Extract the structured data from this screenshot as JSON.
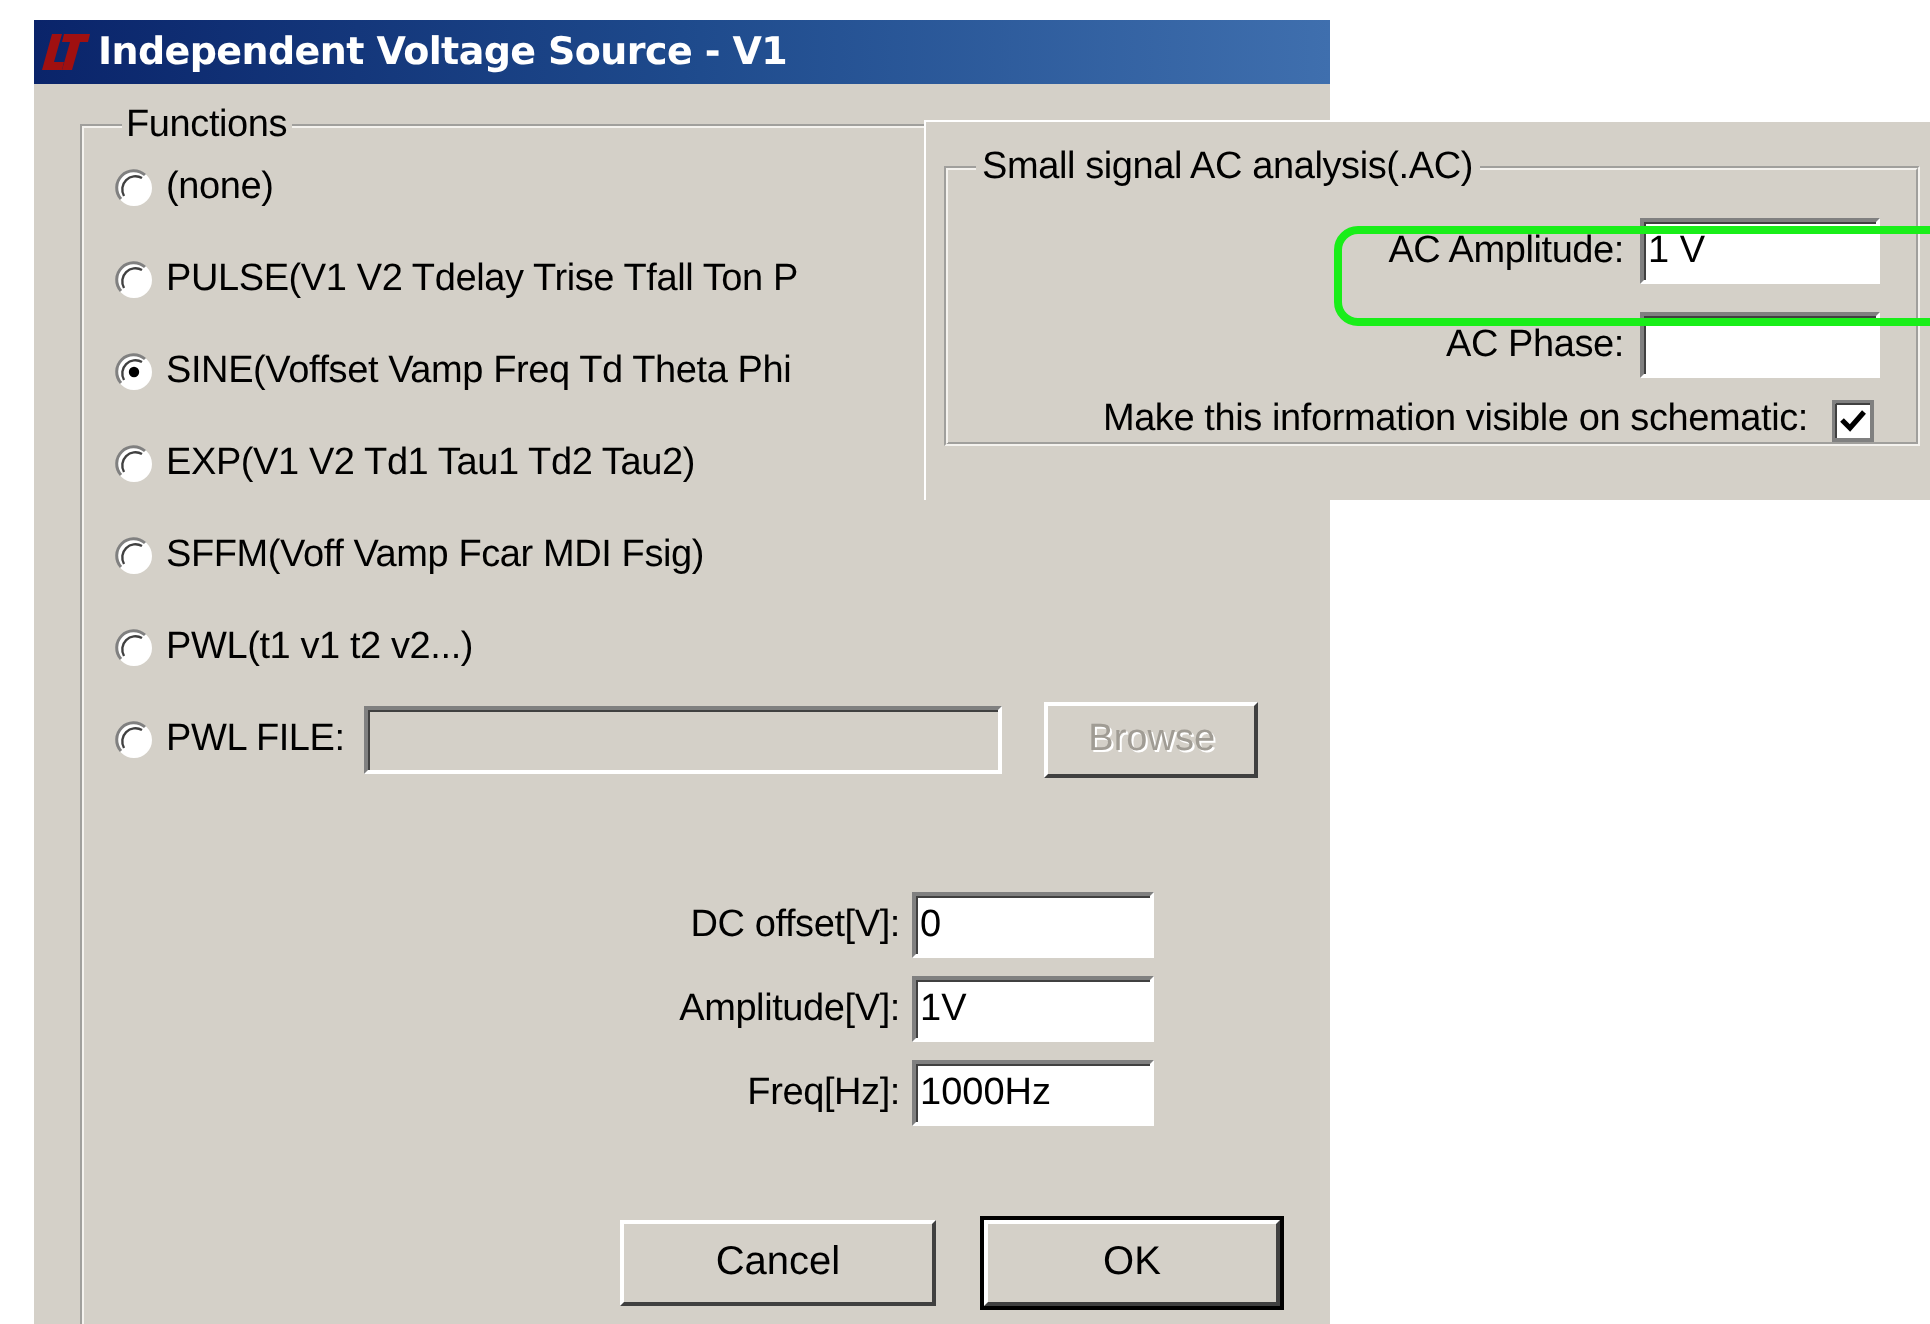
{
  "window": {
    "title": "Independent Voltage Source - V1"
  },
  "functions": {
    "label": "Functions",
    "options": [
      {
        "label": "(none)",
        "selected": false,
        "kind": "plain"
      },
      {
        "label": "PULSE(V1 V2 Tdelay Trise Tfall Ton P",
        "selected": false,
        "kind": "plain"
      },
      {
        "label": "SINE(Voffset Vamp Freq Td Theta Phi",
        "selected": true,
        "kind": "plain"
      },
      {
        "label": "EXP(V1 V2 Td1 Tau1 Td2 Tau2)",
        "selected": false,
        "kind": "plain"
      },
      {
        "label": "SFFM(Voff Vamp Fcar MDI Fsig)",
        "selected": false,
        "kind": "plain"
      },
      {
        "label": "PWL(t1 v1 t2 v2...)",
        "selected": false,
        "kind": "plain"
      },
      {
        "label": "PWL FILE:",
        "selected": false,
        "kind": "file",
        "file_field": {
          "disabled": true
        },
        "browse_button": {
          "label": "Browse",
          "disabled": true
        }
      }
    ]
  },
  "parameters": [
    {
      "label": "DC offset[V]:",
      "value": "0"
    },
    {
      "label": "Amplitude[V]:",
      "value": "1V"
    },
    {
      "label": "Freq[Hz]:",
      "value": "1000Hz"
    }
  ],
  "buttons": [
    {
      "label": "Cancel",
      "default": false
    },
    {
      "label": "OK",
      "default": true
    }
  ],
  "ac_analysis": {
    "title": "Small signal AC analysis(.AC)",
    "fields": [
      {
        "label": "AC Amplitude:",
        "value": "1 V",
        "highlighted": true
      },
      {
        "label": "AC Phase:"
      }
    ],
    "visible_on_schematic": {
      "label": "Make this information visible on schematic:",
      "checked": true
    }
  }
}
